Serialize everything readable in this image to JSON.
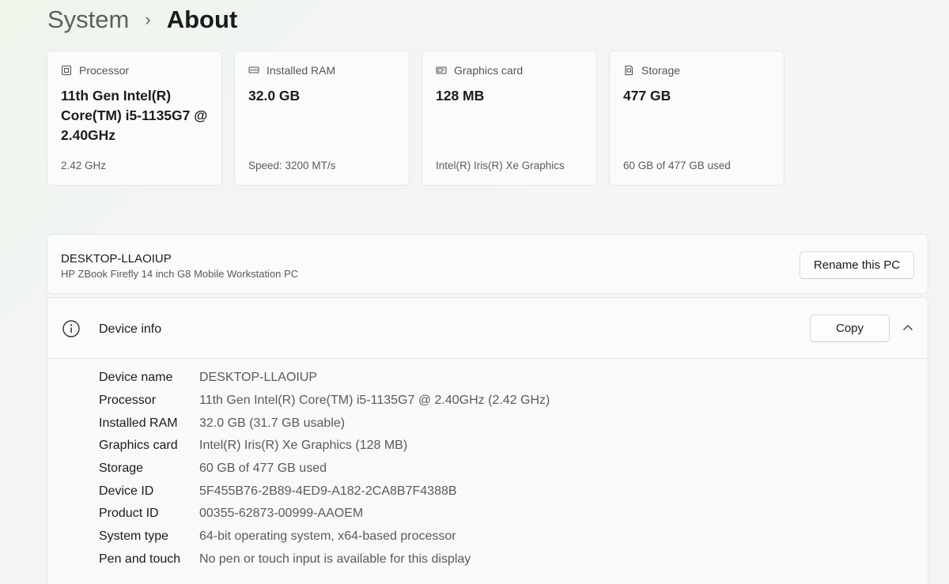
{
  "breadcrumb": {
    "parent": "System",
    "separator": "›",
    "current": "About"
  },
  "cards": [
    {
      "icon": "processor-icon",
      "label": "Processor",
      "value": "11th Gen Intel(R) Core(TM) i5-1135G7 @ 2.40GHz",
      "sub": "2.42 GHz"
    },
    {
      "icon": "ram-icon",
      "label": "Installed RAM",
      "value": "32.0 GB",
      "sub": "Speed: 3200 MT/s"
    },
    {
      "icon": "graphics-card-icon",
      "label": "Graphics card",
      "value": "128 MB",
      "sub": "Intel(R) Iris(R) Xe Graphics"
    },
    {
      "icon": "storage-icon",
      "label": "Storage",
      "value": "477 GB",
      "sub": "60 GB of 477 GB used"
    }
  ],
  "pc": {
    "name": "DESKTOP-LLAOIUP",
    "model": "HP ZBook Firefly 14 inch G8 Mobile Workstation PC",
    "rename_label": "Rename this PC"
  },
  "device_info": {
    "title": "Device info",
    "copy_label": "Copy",
    "rows": [
      {
        "label": "Device name",
        "value": "DESKTOP-LLAOIUP"
      },
      {
        "label": "Processor",
        "value": "11th Gen Intel(R) Core(TM) i5-1135G7 @ 2.40GHz (2.42 GHz)"
      },
      {
        "label": "Installed RAM",
        "value": "32.0 GB (31.7 GB usable)"
      },
      {
        "label": "Graphics card",
        "value": "Intel(R) Iris(R) Xe Graphics (128 MB)"
      },
      {
        "label": "Storage",
        "value": "60 GB of 477 GB used"
      },
      {
        "label": "Device ID",
        "value": "5F455B76-2B89-4ED9-A182-2CA8B7F4388B"
      },
      {
        "label": "Product ID",
        "value": "00355-62873-00999-AAOEM"
      },
      {
        "label": "System type",
        "value": "64-bit operating system, x64-based processor"
      },
      {
        "label": "Pen and touch",
        "value": "No pen or touch input is available for this display"
      }
    ]
  }
}
